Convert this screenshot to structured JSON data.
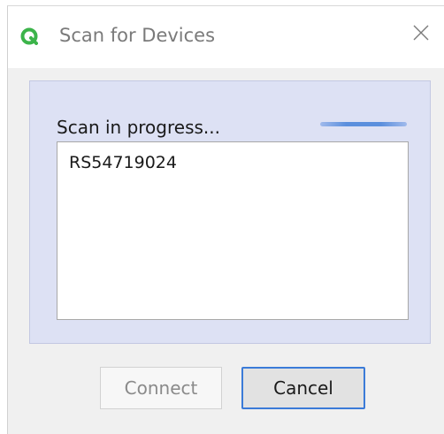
{
  "window": {
    "title": "Scan for Devices",
    "app_icon": "app-logo-icon",
    "close_icon": "close-icon"
  },
  "scan": {
    "status_label": "Scan in progress...",
    "progress_state": "indeterminate"
  },
  "devices": [
    {
      "name": "RS54719024"
    }
  ],
  "buttons": {
    "connect_label": "Connect",
    "connect_enabled": false,
    "cancel_label": "Cancel"
  },
  "colors": {
    "accent": "#3b7bd8",
    "panel_bg": "#dde1f4",
    "logo_green": "#3cb44a"
  }
}
